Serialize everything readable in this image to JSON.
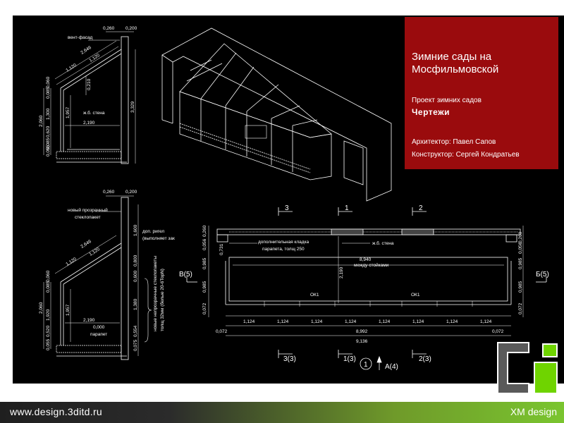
{
  "title_block": {
    "title_line1": "Зимние сады на",
    "title_line2": "Мосфильмовской",
    "subtitle": "Проект зимних садов",
    "section": "Чертежи",
    "architect": "Архитектор: Павел Сапов",
    "constructor": "Конструктор: Сергей Кондратьев"
  },
  "section_top": {
    "dims_top": [
      "0,260",
      "0,200"
    ],
    "label_facade": "вент-фасад",
    "slope": [
      "2,646",
      "1,120",
      "1,120"
    ],
    "left_vert": [
      "0,085",
      "0,060",
      "1,300",
      "0,620",
      "0,085",
      "0,055",
      "2,060"
    ],
    "inner": [
      "1,957",
      "2,190",
      "0,210"
    ],
    "right_vert": "3,329",
    "wall_label": "ж.б. стена"
  },
  "section_bottom": {
    "dims_top": [
      "0,260",
      "0,200"
    ],
    "label_glass": [
      "новый прозрачный",
      "стеклопакет"
    ],
    "label_rigel": [
      "доп. ригел",
      "(выполняет зак"
    ],
    "slope": [
      "2,646",
      "1,120",
      "1,120"
    ],
    "inner": [
      "1,957",
      "2,190",
      "0,000",
      "парапет"
    ],
    "left_vert": [
      "0,085",
      "0,060",
      "1,920",
      "0,520",
      "2,060",
      "0,055"
    ],
    "right_vert": [
      "1,600",
      "0,800",
      "0,600",
      "1,380",
      "0,554",
      "0,075"
    ],
    "side_note": [
      "новые непрозрачные стеклопакеты",
      "толщ 32мм (белые 20-6ТорN)"
    ]
  },
  "plan": {
    "axes_top": [
      "3",
      "1",
      "2"
    ],
    "axes_bottom": [
      "3(3)",
      "1(3)",
      "2(3)",
      "1",
      "A(4)"
    ],
    "side_left": "B(5)",
    "side_right": "Б(5)",
    "masonry": [
      "дополнительная кладка",
      "парапета, толщ 250"
    ],
    "wall": "ж.б. стена",
    "span": "8,940",
    "span_note": "между стойками",
    "depth": "2,190",
    "windows": [
      "ОК1",
      "ОК1"
    ],
    "left_dims": [
      "0,260",
      "0,056",
      "0,731",
      "0,985",
      "0,985",
      "0,072"
    ],
    "right_dims": [
      "0,260",
      "0,056",
      "0,985",
      "0,985",
      "0,072"
    ],
    "bays": [
      "1,124",
      "1,124",
      "1,124",
      "1,124",
      "1,124",
      "1,124",
      "1,124",
      "1,124"
    ],
    "total_inner": "8,992",
    "total": "9,136",
    "edge": [
      "0,072",
      "0,072"
    ]
  },
  "footer": {
    "url": "www.design.3ditd.ru",
    "brand": "XM design"
  },
  "colors": {
    "sheet": "#000000",
    "title_block": "#9a0b0d",
    "line": "#ffffff",
    "logo_green": "#6fd400",
    "logo_grey": "#5a5a5a"
  }
}
